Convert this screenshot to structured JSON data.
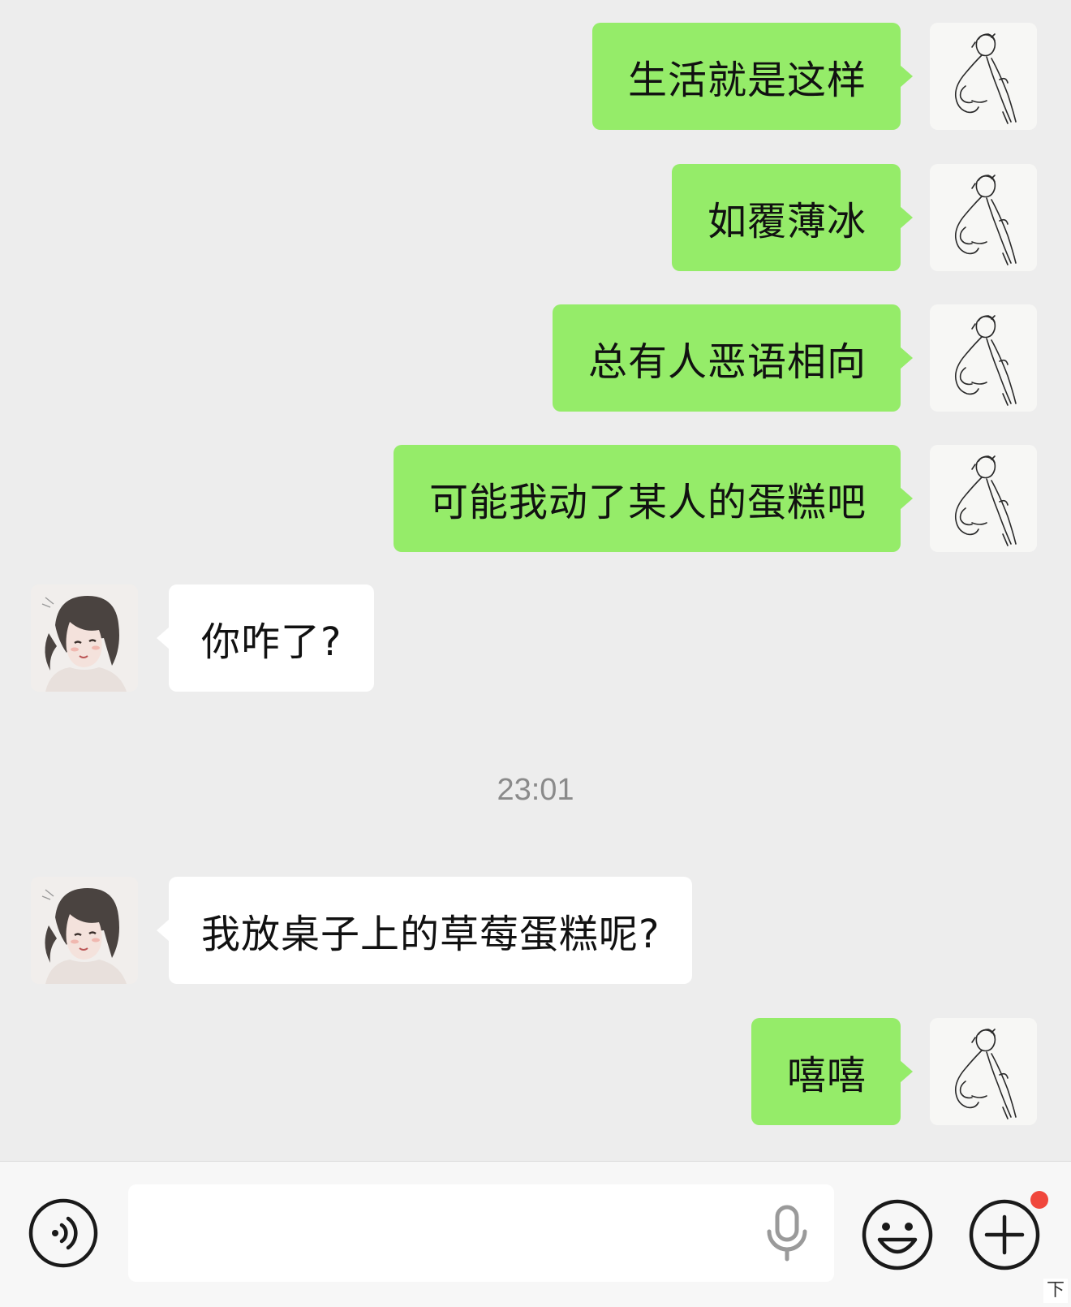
{
  "messages": [
    {
      "sender": "self",
      "text": "生活就是这样"
    },
    {
      "sender": "self",
      "text": "如覆薄冰"
    },
    {
      "sender": "self",
      "text": "总有人恶语相向"
    },
    {
      "sender": "self",
      "text": "可能我动了某人的蛋糕吧"
    },
    {
      "sender": "other",
      "text": "你咋了?"
    },
    {
      "sender": "other",
      "text": "我放桌子上的草莓蛋糕呢?"
    },
    {
      "sender": "self",
      "text": "嘻嘻"
    }
  ],
  "timestamp": "23:01",
  "input": {
    "value": "",
    "placeholder": ""
  },
  "icons": {
    "voice": "voice-icon",
    "mic": "mic-icon",
    "emoji": "emoji-icon",
    "plus": "plus-icon",
    "notification": "red-dot"
  },
  "colors": {
    "self_bubble": "#95ec69",
    "other_bubble": "#ffffff",
    "background": "#ededed",
    "notification_dot": "#f0473c"
  },
  "corner_mark": "下"
}
